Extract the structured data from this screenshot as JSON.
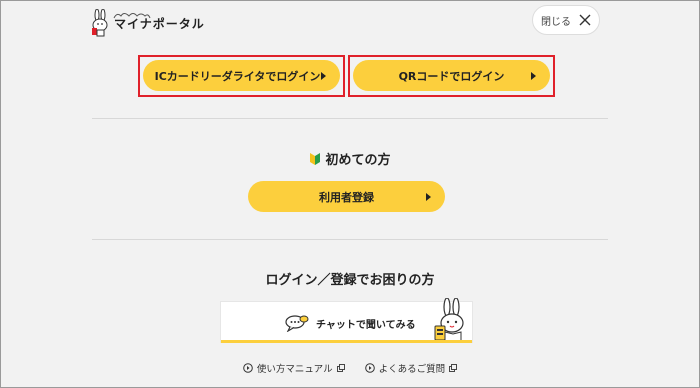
{
  "header": {
    "logo_text": "マイナポータル",
    "close_label": "閉じる"
  },
  "login": {
    "ic_label": "ICカードリーダライタでログイン",
    "qr_label": "QRコードでログイン"
  },
  "first_time": {
    "heading": "初めての方",
    "register_label": "利用者登録"
  },
  "help": {
    "heading": "ログイン／登録でお困りの方",
    "chat_label": "チャットで聞いてみる"
  },
  "footer": {
    "manual_label": "使い方マニュアル",
    "faq_label": "よくあるご質問"
  },
  "colors": {
    "accent": "#fccf3d",
    "highlight": "#e0202a",
    "background": "#f2f2f2"
  }
}
